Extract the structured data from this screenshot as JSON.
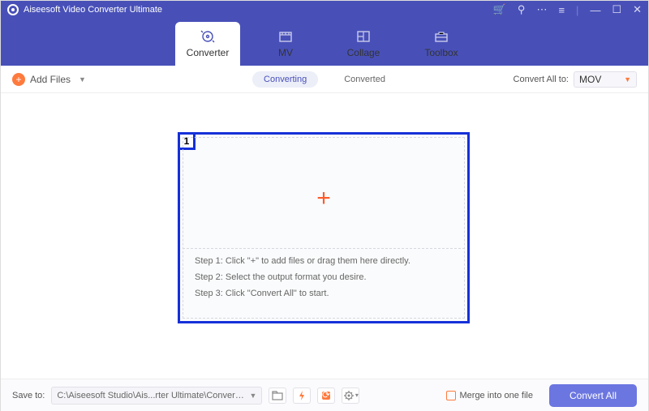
{
  "title": "Aiseesoft Video Converter Ultimate",
  "tabs": [
    {
      "label": "Converter"
    },
    {
      "label": "MV"
    },
    {
      "label": "Collage"
    },
    {
      "label": "Toolbox"
    }
  ],
  "toolbar": {
    "add_files": "Add Files",
    "subtabs": {
      "converting": "Converting",
      "converted": "Converted"
    },
    "convert_all_to": "Convert All to:",
    "format": "MOV"
  },
  "dropzone": {
    "badge": "1",
    "step1": "Step 1: Click \"+\" to add files or drag them here directly.",
    "step2": "Step 2: Select the output format you desire.",
    "step3": "Step 3: Click \"Convert All\" to start."
  },
  "footer": {
    "save_to": "Save to:",
    "path": "C:\\Aiseesoft Studio\\Ais...rter Ultimate\\Converted",
    "merge": "Merge into one file",
    "convert_all": "Convert All"
  }
}
